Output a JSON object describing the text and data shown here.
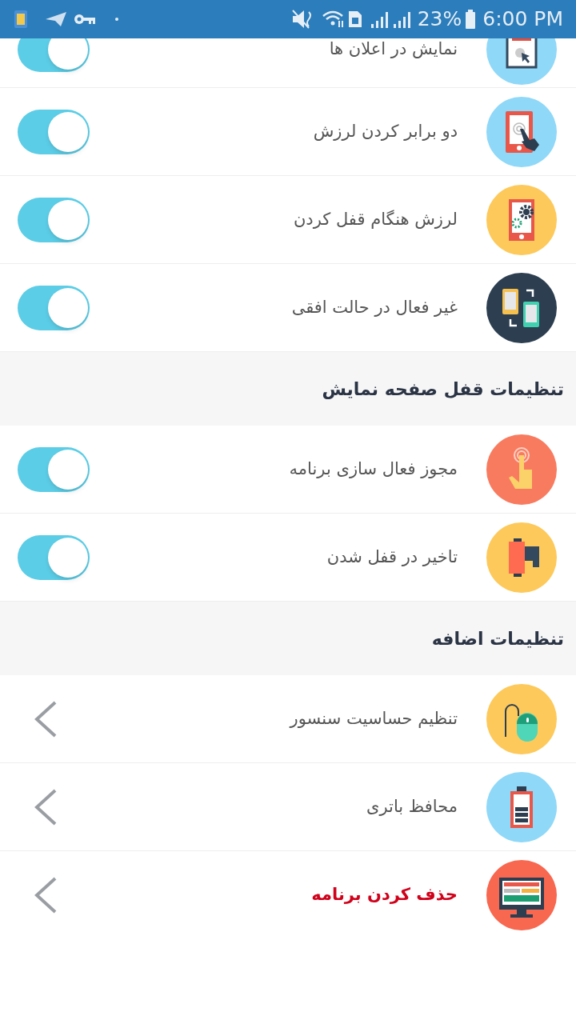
{
  "status_bar": {
    "battery_text": "23%",
    "time": "6:00 PM"
  },
  "sections": [
    {
      "items": [
        {
          "kind": "toggle",
          "label": "نمایش در اعلان ها",
          "on": true
        },
        {
          "kind": "toggle",
          "label": "دو برابر کردن لرزش",
          "on": true
        },
        {
          "kind": "toggle",
          "label": "لرزش هنگام قفل کردن",
          "on": true
        },
        {
          "kind": "toggle",
          "label": "غیر فعال در حالت افقی",
          "on": true
        }
      ]
    },
    {
      "title": "تنظیمات قفل صفحه نمایش",
      "items": [
        {
          "kind": "toggle",
          "label": "مجوز فعال سازی برنامه",
          "on": true
        },
        {
          "kind": "toggle",
          "label": "تاخیر در قفل شدن",
          "on": true
        }
      ]
    },
    {
      "title": "تنظیمات اضافه",
      "items": [
        {
          "kind": "link",
          "label": "تنظیم حساسیت سنسور",
          "danger": false
        },
        {
          "kind": "link",
          "label": "محافظ باتری",
          "danger": false
        },
        {
          "kind": "link",
          "label": "حذف کردن برنامه",
          "danger": true
        }
      ]
    }
  ]
}
